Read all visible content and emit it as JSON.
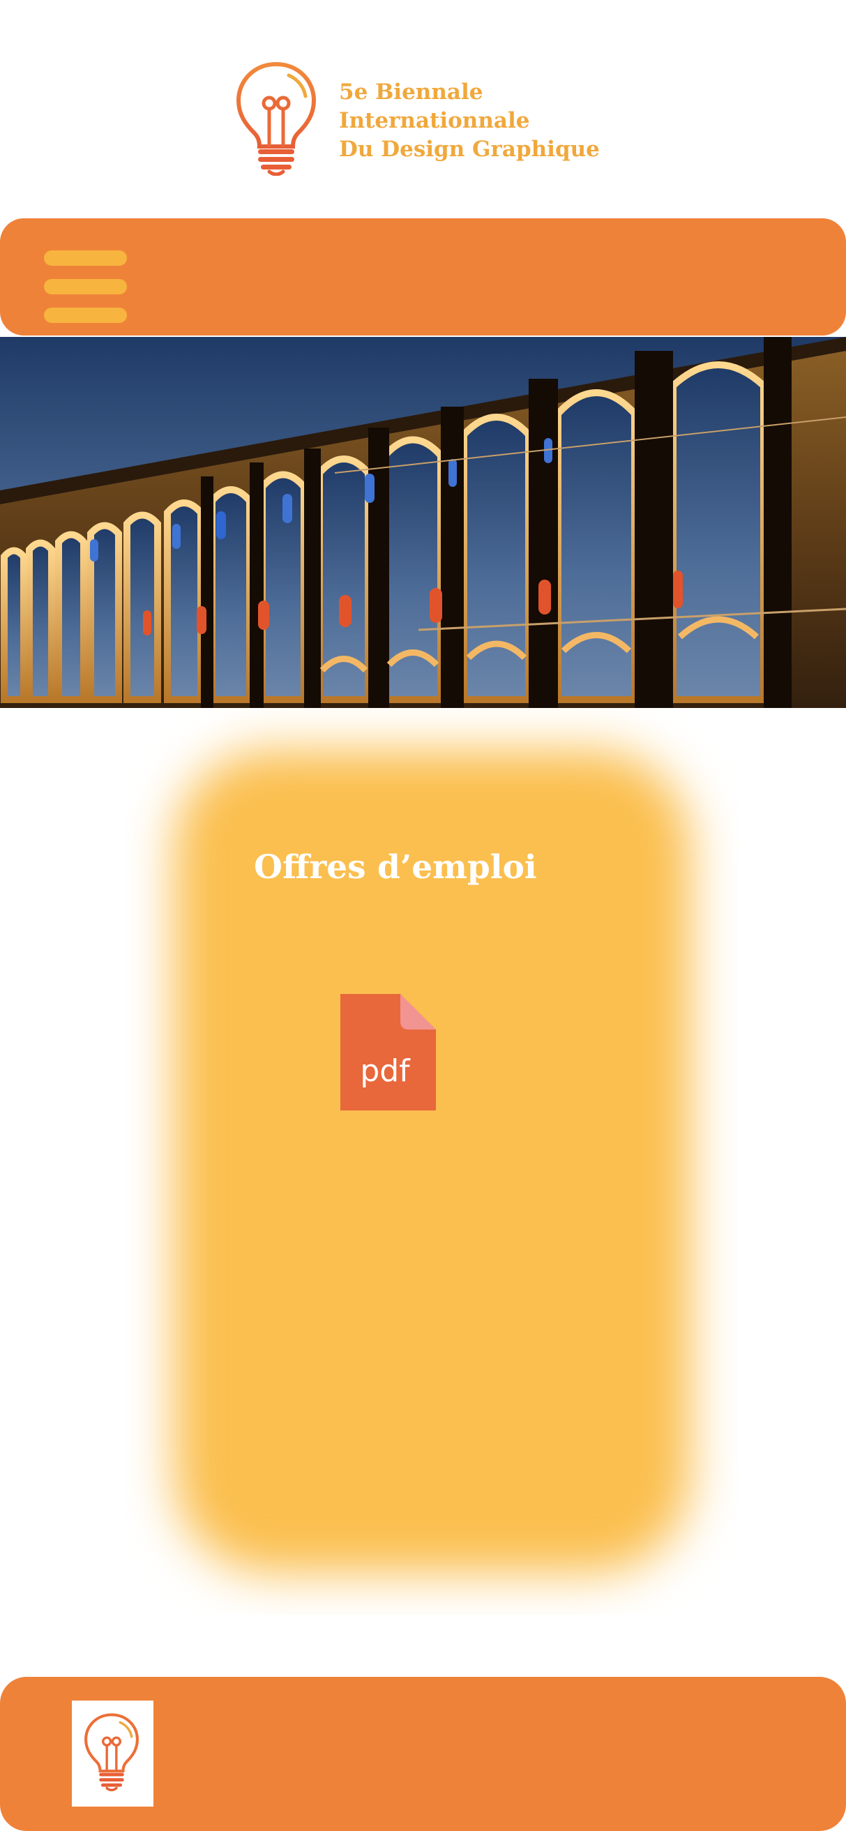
{
  "brand": {
    "line1": "5e Biennale",
    "line2": "Internationnale",
    "line3": "Du Design Graphique",
    "logo_icon": "lightbulb-icon",
    "text_color": "#f0a83c"
  },
  "nav": {
    "menu_icon": "hamburger-menu-icon",
    "bar_color": "#ef8239",
    "accent_color": "#f7b43f"
  },
  "hero": {
    "image": "illuminated-aqueduct-photo"
  },
  "main": {
    "title": "Offres d’emploi",
    "document": {
      "icon": "pdf-file-icon",
      "label": "pdf",
      "color": "#e8673b"
    },
    "card_color": "#fbbf4f"
  },
  "footer": {
    "logo_icon": "lightbulb-icon",
    "bar_color": "#ef8239"
  }
}
